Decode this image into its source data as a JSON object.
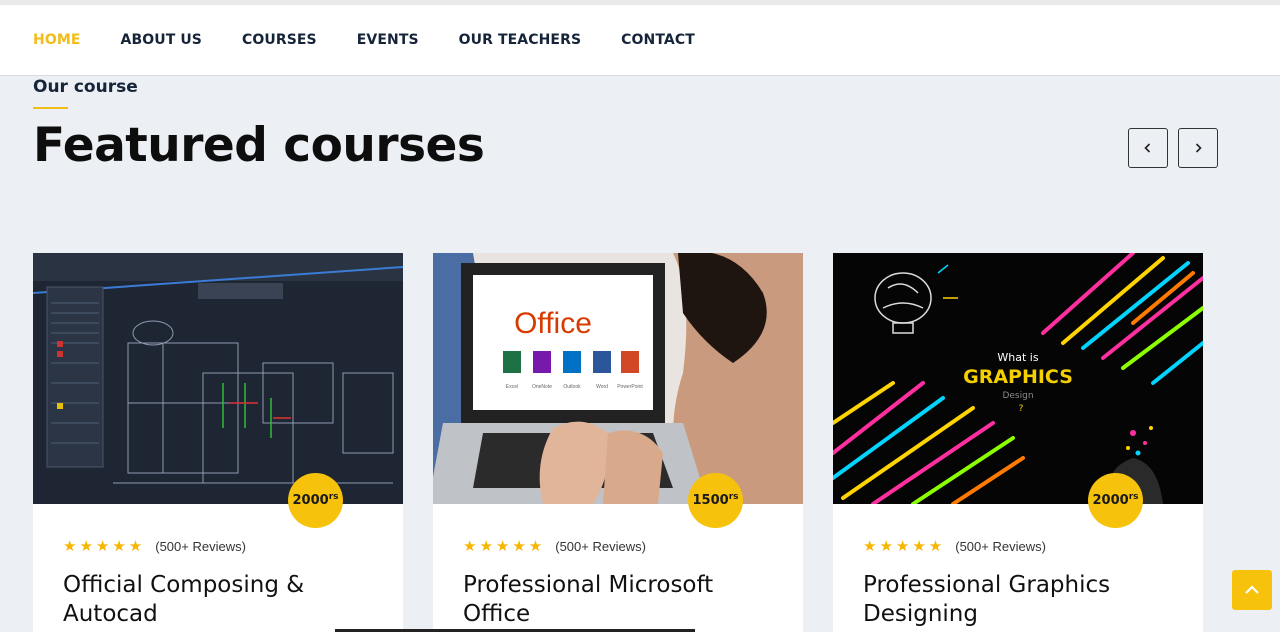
{
  "nav": {
    "items": [
      {
        "label": "HOME",
        "active": true
      },
      {
        "label": "ABOUT US"
      },
      {
        "label": "COURSES"
      },
      {
        "label": "EVENTS"
      },
      {
        "label": "OUR TEACHERS"
      },
      {
        "label": "CONTACT"
      }
    ]
  },
  "section": {
    "subtitle": "Our course",
    "heading": "Featured courses"
  },
  "courses": [
    {
      "title": "Official Composing & Autocad",
      "price": "2000",
      "price_unit": "rs",
      "reviews": "(500+ Reviews)",
      "rating": 5,
      "image": "autocad-blueprint"
    },
    {
      "title": "Professional Microsoft Office",
      "price": "1500",
      "price_unit": "rs",
      "reviews": "(500+ Reviews)",
      "rating": 5,
      "image": "laptop-office"
    },
    {
      "title": "Professional Graphics Designing",
      "price": "2000",
      "price_unit": "rs",
      "reviews": "(500+ Reviews)",
      "rating": 5,
      "image": "graphics-design"
    }
  ],
  "thumb_text": {
    "office_brand": "Office",
    "office_apps": [
      "Excel",
      "OneNote",
      "Outlook",
      "Word",
      "PowerPoint"
    ],
    "graphics_line1": "What is",
    "graphics_line2": "GRAPHICS",
    "graphics_line3": "Design",
    "graphics_q": "?"
  },
  "colors": {
    "accent": "#f7c20c",
    "nav_active": "#f2bd17",
    "dark_text": "#16243a",
    "background": "#eceff3"
  },
  "icons": {
    "prev": "chevron-left-icon",
    "next": "chevron-right-icon",
    "scroll_top": "chevron-up-icon",
    "star": "star-icon"
  }
}
